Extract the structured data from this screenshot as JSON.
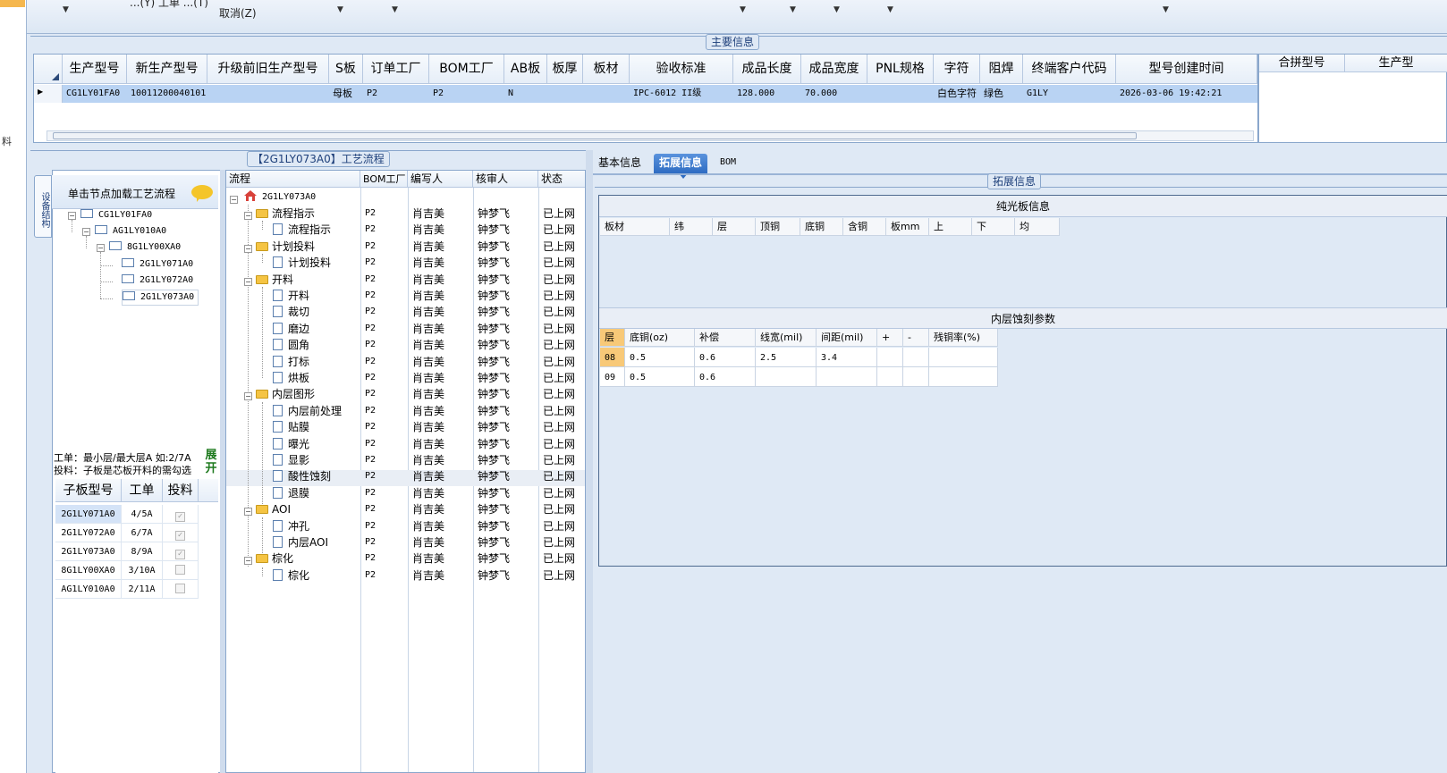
{
  "toolbar": {
    "cancel_label": "取消(Z)",
    "cut_text": "...(Y) 工单 ...(T)"
  },
  "left_strip": {
    "char": "料"
  },
  "main_info": {
    "group_title": "主要信息",
    "columns": [
      "生产型号",
      "新生产型号",
      "升级前旧生产型号",
      "S板",
      "订单工厂",
      "BOM工厂",
      "AB板",
      "板厚",
      "板材",
      "验收标准",
      "成品长度",
      "成品宽度",
      "PNL规格",
      "字符",
      "阻焊",
      "终端客户代码",
      "型号创建时间"
    ],
    "row": {
      "prod_model": "CG1LY01FA0",
      "new_model": "10011200040101",
      "old_model": "",
      "s_board": "母板",
      "order_factory": "P2",
      "bom_factory": "P2",
      "ab_board": "N",
      "thickness": "",
      "material": "",
      "standard": "IPC-6012 II级",
      "length": "128.000",
      "width": "70.000",
      "pnl": "",
      "character": "白色字符",
      "solder_mask": "绿色",
      "customer_code": "G1LY",
      "created": "2026-03-06 19:42:21"
    },
    "merge_columns": [
      "合拼型号",
      "生产型"
    ]
  },
  "structure": {
    "vtab_label": "设备结构",
    "tree_header": "单击节点加载工艺流程",
    "tree": [
      "CG1LY01FA0",
      "AG1LY010A0",
      "8G1LY00XA0",
      "2G1LY071A0",
      "2G1LY072A0",
      "2G1LY073A0"
    ],
    "note_line1": "工单：最小层/最大层A 如:2/7A",
    "note_line2": "投料：子板是芯板开料的需勾选",
    "expand_label": "展开",
    "sub_columns": [
      "子板型号",
      "工单",
      "投料"
    ],
    "sub_rows": [
      {
        "model": "2G1LY071A0",
        "order": "4/5A",
        "feed": "✓"
      },
      {
        "model": "2G1LY072A0",
        "order": "6/7A",
        "feed": "✓"
      },
      {
        "model": "2G1LY073A0",
        "order": "8/9A",
        "feed": "✓"
      },
      {
        "model": "8G1LY00XA0",
        "order": "3/10A",
        "feed": ""
      },
      {
        "model": "AG1LY010A0",
        "order": "2/11A",
        "feed": ""
      }
    ]
  },
  "flow": {
    "title": "【2G1LY073A0】工艺流程",
    "columns": [
      "流程",
      "BOM工厂",
      "编写人",
      "核审人",
      "状态"
    ],
    "root": "2G1LY073A0",
    "rows": [
      {
        "name": "流程指示",
        "f": "P2",
        "w": "肖吉美",
        "r": "钟梦飞",
        "s": "已上网"
      },
      {
        "name": "流程指示",
        "f": "P2",
        "w": "肖吉美",
        "r": "钟梦飞",
        "s": "已上网"
      },
      {
        "name": "计划投料",
        "f": "P2",
        "w": "肖吉美",
        "r": "钟梦飞",
        "s": "已上网"
      },
      {
        "name": "计划投料",
        "f": "P2",
        "w": "肖吉美",
        "r": "钟梦飞",
        "s": "已上网"
      },
      {
        "name": "开料",
        "f": "P2",
        "w": "肖吉美",
        "r": "钟梦飞",
        "s": "已上网"
      },
      {
        "name": "开料",
        "f": "P2",
        "w": "肖吉美",
        "r": "钟梦飞",
        "s": "已上网"
      },
      {
        "name": "裁切",
        "f": "P2",
        "w": "肖吉美",
        "r": "钟梦飞",
        "s": "已上网"
      },
      {
        "name": "磨边",
        "f": "P2",
        "w": "肖吉美",
        "r": "钟梦飞",
        "s": "已上网"
      },
      {
        "name": "圆角",
        "f": "P2",
        "w": "肖吉美",
        "r": "钟梦飞",
        "s": "已上网"
      },
      {
        "name": "打标",
        "f": "P2",
        "w": "肖吉美",
        "r": "钟梦飞",
        "s": "已上网"
      },
      {
        "name": "烘板",
        "f": "P2",
        "w": "肖吉美",
        "r": "钟梦飞",
        "s": "已上网"
      },
      {
        "name": "内层图形",
        "f": "P2",
        "w": "肖吉美",
        "r": "钟梦飞",
        "s": "已上网"
      },
      {
        "name": "内层前处理",
        "f": "P2",
        "w": "肖吉美",
        "r": "钟梦飞",
        "s": "已上网"
      },
      {
        "name": "贴膜",
        "f": "P2",
        "w": "肖吉美",
        "r": "钟梦飞",
        "s": "已上网"
      },
      {
        "name": "曝光",
        "f": "P2",
        "w": "肖吉美",
        "r": "钟梦飞",
        "s": "已上网"
      },
      {
        "name": "显影",
        "f": "P2",
        "w": "肖吉美",
        "r": "钟梦飞",
        "s": "已上网"
      },
      {
        "name": "酸性蚀刻",
        "f": "P2",
        "w": "肖吉美",
        "r": "钟梦飞",
        "s": "已上网"
      },
      {
        "name": "退膜",
        "f": "P2",
        "w": "肖吉美",
        "r": "钟梦飞",
        "s": "已上网"
      },
      {
        "name": "AOI",
        "f": "P2",
        "w": "肖吉美",
        "r": "钟梦飞",
        "s": "已上网"
      },
      {
        "name": "冲孔",
        "f": "P2",
        "w": "肖吉美",
        "r": "钟梦飞",
        "s": "已上网"
      },
      {
        "name": "内层AOI",
        "f": "P2",
        "w": "肖吉美",
        "r": "钟梦飞",
        "s": "已上网"
      },
      {
        "name": "棕化",
        "f": "P2",
        "w": "肖吉美",
        "r": "钟梦飞",
        "s": "已上网"
      },
      {
        "name": "棕化",
        "f": "P2",
        "w": "肖吉美",
        "r": "钟梦飞",
        "s": "已上网"
      }
    ]
  },
  "right": {
    "tabs": [
      "基本信息",
      "拓展信息",
      "BOM"
    ],
    "active_tab": "拓展信息",
    "group_title": "拓展信息",
    "light_board_title": "纯光板信息",
    "light_board_columns": [
      "板材",
      "纬",
      "层",
      "顶铜",
      "底铜",
      "含铜",
      "板mm",
      "上",
      "下",
      "均"
    ],
    "etch_title": "内层蚀刻参数",
    "etch_columns": [
      "层",
      "底铜(oz)",
      "补偿",
      "线宽(mil)",
      "间距(mil)",
      "+",
      "-",
      "残铜率(%)"
    ],
    "etch_rows": [
      [
        "08",
        "0.5",
        "0.6",
        "2.5",
        "3.4",
        "",
        "",
        ""
      ],
      [
        "09",
        "0.5",
        "0.6",
        "",
        "",
        "",
        "",
        ""
      ]
    ]
  },
  "colors": {
    "selected_row": "#b9d3f3",
    "active_tab": "#2e6cc2",
    "panel_bg": "#dfe9f5",
    "highlight_cell": "#f8c978"
  }
}
